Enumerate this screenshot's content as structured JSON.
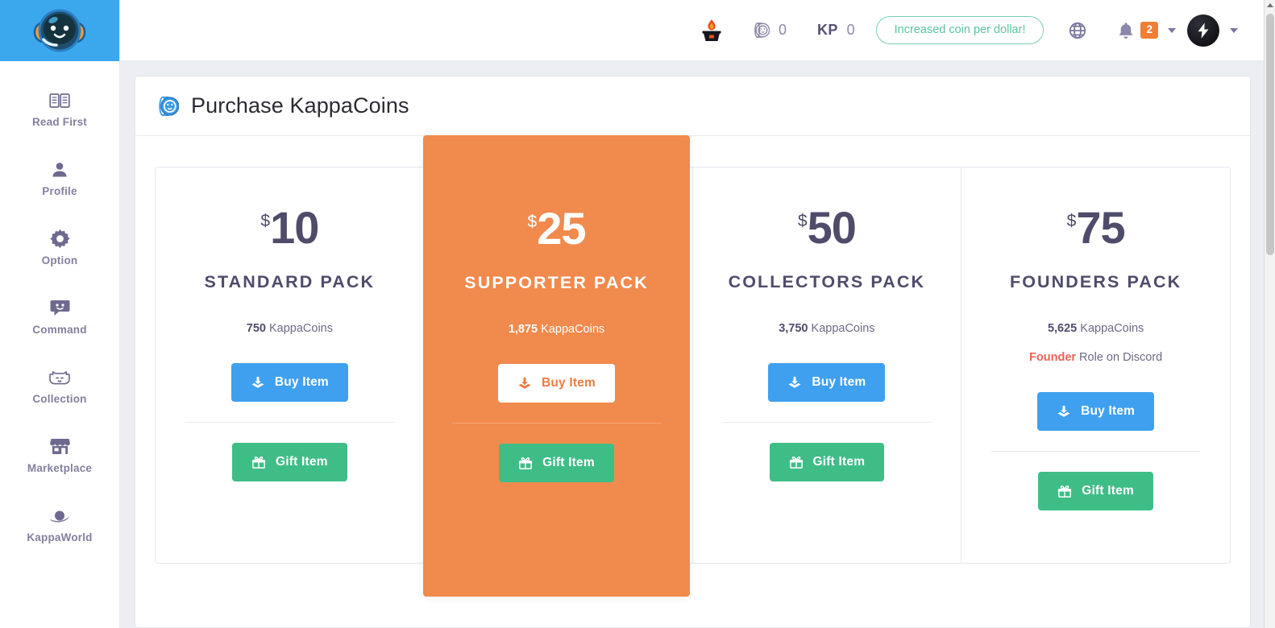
{
  "brand": {
    "logo_alt": "KappaBot mascot logo",
    "logo_bg": "#3ba8ee"
  },
  "sidebar": {
    "items": [
      {
        "label": "Read First",
        "icon": "book-icon"
      },
      {
        "label": "Profile",
        "icon": "user-icon"
      },
      {
        "label": "Option",
        "icon": "gear-icon"
      },
      {
        "label": "Command",
        "icon": "chat-bubble-icon"
      },
      {
        "label": "Collection",
        "icon": "cat-face-icon"
      },
      {
        "label": "Marketplace",
        "icon": "store-icon"
      },
      {
        "label": "KappaWorld",
        "icon": "planet-icon"
      }
    ]
  },
  "topbar": {
    "torch_icon": "flame-brazier-icon",
    "coin_icon": "coin-stack-icon",
    "coin_value": "0",
    "kp_label": "KP",
    "kp_value": "0",
    "promo_text": "Increased coin per dollar!",
    "promo_color": "#5cc3a0",
    "globe_icon": "globe-icon",
    "bell_icon": "bell-icon",
    "notification_count": "2",
    "notification_badge_color": "#f07f36",
    "avatar_icon": "lightning-bolt-avatar"
  },
  "page": {
    "title": "Purchase KappaCoins",
    "title_icon": "coin-stack-icon",
    "title_icon_color": "#3c9ae8"
  },
  "plans": [
    {
      "currency": "$",
      "amount": "10",
      "name": "Standard Pack",
      "coins_amount": "750",
      "coins_unit": "KappaCoins",
      "extra_highlight": "",
      "extra_text": "",
      "buy_label": "Buy Item",
      "gift_label": "Gift Item",
      "featured": "false"
    },
    {
      "currency": "$",
      "amount": "25",
      "name": "Supporter Pack",
      "coins_amount": "1,875",
      "coins_unit": "KappaCoins",
      "extra_highlight": "",
      "extra_text": "",
      "buy_label": "Buy Item",
      "gift_label": "Gift Item",
      "featured": "true"
    },
    {
      "currency": "$",
      "amount": "50",
      "name": "Collectors Pack",
      "coins_amount": "3,750",
      "coins_unit": "KappaCoins",
      "extra_highlight": "",
      "extra_text": "",
      "buy_label": "Buy Item",
      "gift_label": "Gift Item",
      "featured": "false"
    },
    {
      "currency": "$",
      "amount": "75",
      "name": "Founders Pack",
      "coins_amount": "5,625",
      "coins_unit": "KappaCoins",
      "extra_highlight": "Founder",
      "extra_text": " Role on Discord",
      "buy_label": "Buy Item",
      "gift_label": "Gift Item",
      "featured": "false"
    }
  ],
  "colors": {
    "accent_blue": "#3fa0ef",
    "accent_green": "#3fbd87",
    "featured_orange": "#f18a4d",
    "text_dark": "#4f4c6b",
    "red_highlight": "#f0615a"
  }
}
